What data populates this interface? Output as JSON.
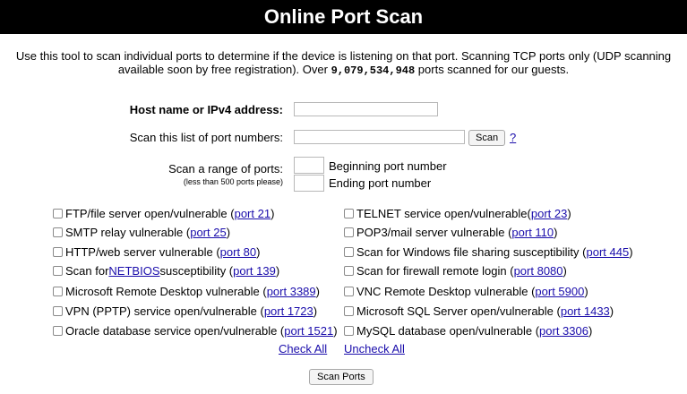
{
  "header": {
    "title": "Online Port Scan"
  },
  "intro": {
    "line1": "Use this tool to scan individual ports to determine if the device is listening on that port.  Scanning TCP ports only (UDP scanning",
    "line2_prefix": "available soon by free registration).  Over ",
    "count": "9,079,534,948",
    "line2_suffix": " ports scanned for our guests."
  },
  "form": {
    "host_label": "Host name or IPv4 address:",
    "host_value": "",
    "list_label": "Scan this list of port numbers:",
    "list_value": "",
    "scan_button": "Scan",
    "help_link": "?",
    "range_label": "Scan a range of ports:",
    "range_note": "(less than 500 ports please)",
    "begin_label": "Beginning port number",
    "end_label": "Ending port number",
    "begin_value": "",
    "end_value": ""
  },
  "options_left": [
    {
      "pre": "FTP/file server open/vulnerable (",
      "link": "port 21",
      "post": ")",
      "checked": false
    },
    {
      "pre": "SMTP relay vulnerable (",
      "link": "port 25",
      "post": ")",
      "checked": false
    },
    {
      "pre": "HTTP/web server vulnerable (",
      "link": "port 80",
      "post": ")",
      "checked": false
    },
    {
      "pre": "Scan for ",
      "mid_link": "NETBIOS",
      "pre2": " susceptibility (",
      "link": "port 139",
      "post": ")",
      "checked": false
    },
    {
      "pre": "Microsoft Remote Desktop vulnerable (",
      "link": "port 3389",
      "post": ")",
      "checked": false
    },
    {
      "pre": "VPN (PPTP) service open/vulnerable (",
      "link": "port 1723",
      "post": ")",
      "checked": false
    },
    {
      "pre": "Oracle database service open/vulnerable (",
      "link": "port 1521",
      "post": ")",
      "checked": false
    }
  ],
  "options_right": [
    {
      "pre": "TELNET service open/vulnerable(",
      "link": "port 23",
      "post": ")",
      "checked": false
    },
    {
      "pre": "POP3/mail server vulnerable (",
      "link": "port 110",
      "post": ")",
      "checked": false
    },
    {
      "pre": "Scan for Windows file sharing susceptibility (",
      "link": "port 445",
      "post": ")",
      "checked": false
    },
    {
      "pre": "Scan for firewall remote login (",
      "link": "port 8080",
      "post": ")",
      "checked": false
    },
    {
      "pre": "VNC Remote Desktop vulnerable (",
      "link": "port 5900",
      "post": ")",
      "checked": false
    },
    {
      "pre": "Microsoft SQL Server open/vulnerable (",
      "link": "port 1433",
      "post": ")",
      "checked": false
    },
    {
      "pre": "MySQL database open/vulnerable (",
      "link": "port 3306",
      "post": ")",
      "checked": false
    }
  ],
  "actions": {
    "check_all": "Check All",
    "uncheck_all": "Uncheck All",
    "scan_ports": "Scan Ports"
  },
  "colors": {
    "banner_bg": "#000000",
    "banner_text": "#ffffff",
    "link": "#1a0dab"
  }
}
